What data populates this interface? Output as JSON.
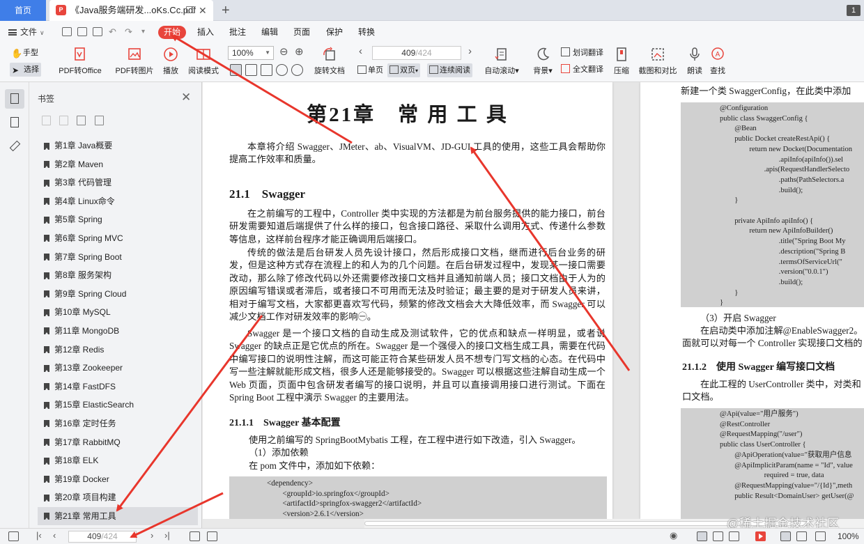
{
  "tabs": {
    "home": "首页",
    "doc_title": "《Java服务端研发...oKs.Cc.pdf",
    "count": "1"
  },
  "menu": {
    "file": "文件",
    "items": [
      "开始",
      "插入",
      "批注",
      "编辑",
      "页面",
      "保护",
      "转换"
    ]
  },
  "ribbon": {
    "hand": "手型",
    "select": "选择",
    "pdf_to_office": "PDF转Office",
    "pdf_to_image": "PDF转图片",
    "play": "播放",
    "read_mode": "阅读模式",
    "zoom": "100%",
    "page_current": "409",
    "page_total": "/424",
    "rotate": "旋转文档",
    "single": "单页",
    "double": "双页",
    "continuous": "连续阅读",
    "auto_scroll": "自动滚动",
    "background": "背景",
    "word_translate": "划词翻译",
    "full_translate": "全文翻译",
    "compress": "压缩",
    "screenshot": "截图和对比",
    "read_aloud": "朗读",
    "search": "查找"
  },
  "bookmarks": {
    "header": "书签",
    "items": [
      "第1章 Java概要",
      "第2章 Maven",
      "第3章 代码管理",
      "第4章 Linux命令",
      "第5章 Spring",
      "第6章 Spring MVC",
      "第7章 Spring Boot",
      "第8章 服务架构",
      "第9章 Spring Cloud",
      "第10章 MySQL",
      "第11章 MongoDB",
      "第12章 Redis",
      "第13章 Zookeeper",
      "第14章 FastDFS",
      "第15章 ElasticSearch",
      "第16章 定时任务",
      "第17章 RabbitMQ",
      "第18章 ELK",
      "第19章 Docker",
      "第20章 项目构建",
      "第21章 常用工具"
    ],
    "selected_index": 20
  },
  "left_page": {
    "chapter_title": "第21章　常 用 工 具",
    "intro": "本章将介绍 Swagger、JMeter、ab、VisualVM、JD-GUI 工具的使用，这些工具会帮助你提高工作效率和质量。",
    "h_21_1": "21.1　Swagger",
    "p1": "在之前编写的工程中，Controller 类中实现的方法都是为前台服务提供的能力接口，前台研发需要知道后端提供了什么样的接口，包含接口路径、采取什么调用方式、传递什么参数等信息，这样前台程序才能正确调用后端接口。",
    "p2": "传统的做法是后台研发人员先设计接口，然后形成接口文档，继而进行后台业务的研发，但是这种方式存在流程上的和人为的几个问题。在后台研发过程中，发现某一接口需要改动，那么除了修改代码以外还需要修改接口文档并且通知前端人员；接口文档由于人为的原因编写错误或者滞后，或者接口不可用而无法及时验证；最主要的是对于研发人员来讲，相对于编写文档，大家都更喜欢写代码，频繁的修改文档会大大降低效率，而 Swagger 可以减少文档工作对研发效率的影响㊀。",
    "p3": "Swagger 是一个接口文档的自动生成及测试软件，它的优点和缺点一样明显，或者说 Swagger 的缺点正是它优点的所在。Swagger 是一个强侵入的接口文档生成工具，需要在代码中编写接口的说明性注解，而这可能正符合某些研发人员不想专门写文档的心态。在代码中写一些注解就能形成文档，很多人还是能够接受的。Swagger 可以根据这些注解自动生成一个 Web 页面，页面中包含研发者编写的接口说明，并且可以直接调用接口进行测试。下面在 Spring Boot 工程中演示 Swagger 的主要用法。",
    "h_21_1_1": "21.1.1　Swagger 基本配置",
    "p4": "使用之前编写的 SpringBootMybatis 工程，在工程中进行如下改造，引入 Swagger。",
    "p5": "（1）添加依赖",
    "p6": "在 pom 文件中，添加如下依赖：",
    "code": "<dependency>\n        <groupId>io.springfox</groupId>\n        <artifactId>springfox-swagger2</artifactId>\n        <version>2.6.1</version>"
  },
  "right_page": {
    "top_text": "新建一个类 SwaggerConfig，在此类中添加",
    "code1": "@Configuration\npublic class SwaggerConfig {\n        @Bean\n        public Docket createRestApi() {\n                return new Docket(Documentation\n                                .apiInfo(apiInfo()).sel\n                        .apis(RequestHandlerSelecto\n                                .paths(PathSelectors.a\n                                .build();\n        }\n\n        private ApiInfo apiInfo() {\n                return new ApiInfoBuilder()\n                                .title(\"Spring Boot My\n                                .description(\"Spring B\n                                .termsOfServiceUrl(\"\n                                .version(\"0.0.1\")\n                                .build();\n        }\n}",
    "step3": "（3）开启 Swagger",
    "step3_text": "在启动类中添加注解@EnableSwagger2。\n面就可以对每一个 Controller 实现接口文档的",
    "h_21_1_2": "21.1.2　使用 Swagger 编写接口文档",
    "p_uc": "在此工程的 UserController 类中，对类和\n口文档。",
    "code2": "@Api(value=\"用户服务\")\n@RestController\n@RequestMapping(\"/user\")\npublic class UserController {\n        @ApiOperation(value=\"获取用户信息\n        @ApiImplicitParam(name = \"Id\", value\n                        required = true, data\n        @RequestMapping(value=\"/{Id}\",meth\n        public Result<DomainUser> getUser(@"
  },
  "status": {
    "page_current": "409",
    "page_total": "/424",
    "zoom": "100%",
    "watermark": "@稀土掘金技术社区"
  },
  "colors": {
    "accent_red": "#e8453c",
    "home_tab_blue": "#3f7ee8",
    "arrow_red": "#e8362c"
  }
}
